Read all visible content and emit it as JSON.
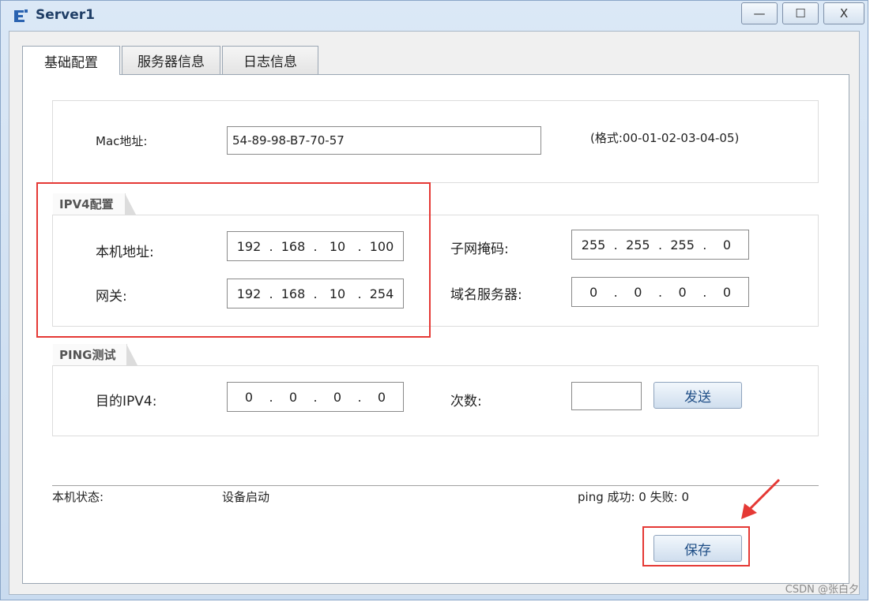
{
  "window": {
    "title": "Server1",
    "controls": {
      "minimize": "—",
      "maximize": "☐",
      "close": "X"
    }
  },
  "tabs": [
    {
      "label": "基础配置",
      "active": true
    },
    {
      "label": "服务器信息",
      "active": false
    },
    {
      "label": "日志信息",
      "active": false
    }
  ],
  "mac": {
    "label": "Mac地址:",
    "value": "54-89-98-B7-70-57",
    "format_hint": "(格式:00-01-02-03-04-05)"
  },
  "ipv4": {
    "legend": "IPV4配置",
    "local_ip_label": "本机地址:",
    "local_ip": [
      "192",
      "168",
      "10",
      "100"
    ],
    "gateway_label": "网关:",
    "gateway": [
      "192",
      "168",
      "10",
      "254"
    ],
    "mask_label": "子网掩码:",
    "mask": [
      "255",
      "255",
      "255",
      "0"
    ],
    "dns_label": "域名服务器:",
    "dns": [
      "0",
      "0",
      "0",
      "0"
    ]
  },
  "ping": {
    "legend": "PING测试",
    "dest_label": "目的IPV4:",
    "dest": [
      "0",
      "0",
      "0",
      "0"
    ],
    "count_label": "次数:",
    "count_value": "",
    "send_button": "发送"
  },
  "status": {
    "label": "本机状态:",
    "value": "设备启动",
    "ping_result": "ping 成功: 0 失败: 0"
  },
  "save_button": "保存",
  "watermark": "CSDN @张白夕",
  "colors": {
    "highlight": "#e53935",
    "title_text": "#1f3e66",
    "button_text": "#1f4e86"
  }
}
